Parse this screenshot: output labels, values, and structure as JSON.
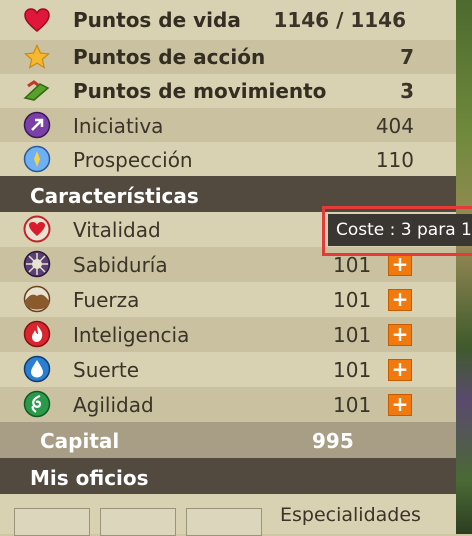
{
  "stats": {
    "life": {
      "label": "Puntos de vida",
      "value": "1146 / 1146"
    },
    "action": {
      "label": "Puntos de acción",
      "value": "7"
    },
    "movement": {
      "label": "Puntos de movimiento",
      "value": "3"
    },
    "initiative": {
      "label": "Iniciativa",
      "value": "404"
    },
    "prospection": {
      "label": "Prospección",
      "value": "110"
    }
  },
  "characteristics": {
    "title": "Características",
    "items": [
      {
        "label": "Vitalidad",
        "value": "101",
        "plus": "+"
      },
      {
        "label": "Sabiduría",
        "value": "101",
        "plus": "+"
      },
      {
        "label": "Fuerza",
        "value": "101",
        "plus": "+"
      },
      {
        "label": "Inteligencia",
        "value": "101",
        "plus": "+"
      },
      {
        "label": "Suerte",
        "value": "101",
        "plus": "+"
      },
      {
        "label": "Agilidad",
        "value": "101",
        "plus": "+"
      }
    ]
  },
  "capital": {
    "label": "Capital",
    "value": "995"
  },
  "jobs": {
    "title": "Mis oficios",
    "specialties_label": "Especialidades"
  },
  "tooltip": {
    "text": "Coste : 3 para 1"
  },
  "colors": {
    "accent_plus": "#f07a10",
    "header_dark": "#524a3e",
    "highlight": "#e33a3a"
  }
}
